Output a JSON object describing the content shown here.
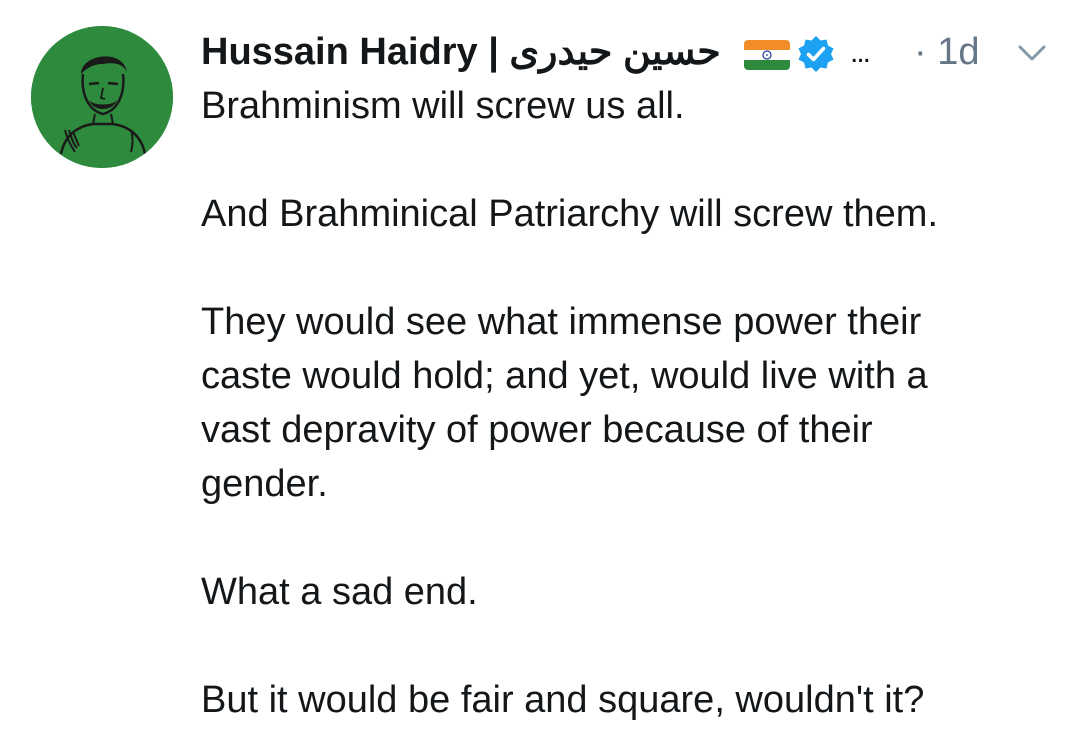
{
  "tweet": {
    "author": {
      "display_name": "Hussain Haidry | حسين حيدرى",
      "avatar_icon": "sketch-portrait-avatar",
      "flag_icon": "india-flag-icon",
      "verified_icon": "verified-badge-icon"
    },
    "more_label": "...",
    "timestamp": "· 1d",
    "paragraphs": [
      "Brahminism will screw us all.",
      "And Brahminical Patriarchy will screw them.",
      "They would see what immense power their caste would hold; and yet, would live with a vast depravity of power because of their gender.",
      "What a sad end.",
      "But it would be fair and square, wouldn't it?"
    ]
  },
  "colors": {
    "text": "#14171a",
    "muted": "#657786",
    "verified_blue": "#1da1f2",
    "avatar_green": "#2e8b3e"
  }
}
